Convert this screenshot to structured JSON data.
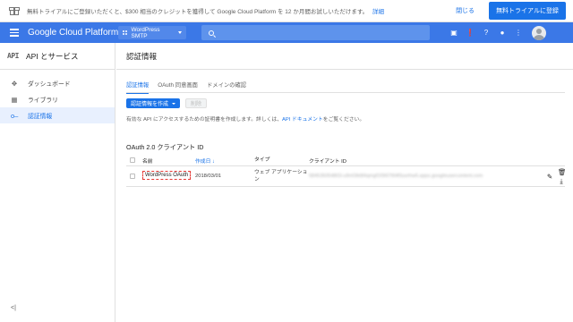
{
  "banner": {
    "icon": "gift-icon",
    "message": "無料トライアルにご登録いただくと、$300 相当のクレジットを獲得して Google Cloud Platform を 12 か月間お試しいただけます。",
    "details_link": "詳細",
    "close_label": "閉じる",
    "trial_button": "無料トライアルに登録"
  },
  "topbar": {
    "brand": "Google Cloud Platform",
    "project": "WordPress SMTP",
    "icons": [
      "cloud-shell-icon",
      "alert-icon",
      "help-icon",
      "notifications-icon",
      "more-icon",
      "account-avatar"
    ]
  },
  "sidebar": {
    "logo": "API",
    "title": "API とサービス",
    "items": [
      {
        "label": "ダッシュボード",
        "icon": "dashboard-icon",
        "active": false
      },
      {
        "label": "ライブラリ",
        "icon": "library-icon",
        "active": false
      },
      {
        "label": "認証情報",
        "icon": "key-icon",
        "active": true
      }
    ],
    "collapse_label": "<|"
  },
  "main": {
    "title": "認証情報",
    "tabs": [
      {
        "label": "認証情報",
        "active": true
      },
      {
        "label": "OAuth 同意画面",
        "active": false
      },
      {
        "label": "ドメインの確認",
        "active": false
      }
    ],
    "create_button": "認証情報を作成",
    "delete_button": "削除",
    "description_prefix": "有効な API にアクセスするための証明書を作成します。詳しくは、",
    "description_link": "API ドキュメント",
    "description_suffix": "をご覧ください。",
    "section_title": "OAuth 2.0 クライアント ID",
    "table": {
      "columns": [
        "名前",
        "作成日",
        "タイプ",
        "クライアント ID"
      ],
      "sort_indicator": "↓",
      "rows": [
        {
          "name": "WordPress OAuth",
          "created": "2018/03/01",
          "type": "ウェブ アプリケーション",
          "client_id": "584535054803-u9n03kt84qmgf1f3t97t94f3uorhw5.apps.googleusercontent.com"
        }
      ]
    },
    "row_actions": [
      "edit-icon",
      "delete-icon",
      "download-icon"
    ]
  }
}
